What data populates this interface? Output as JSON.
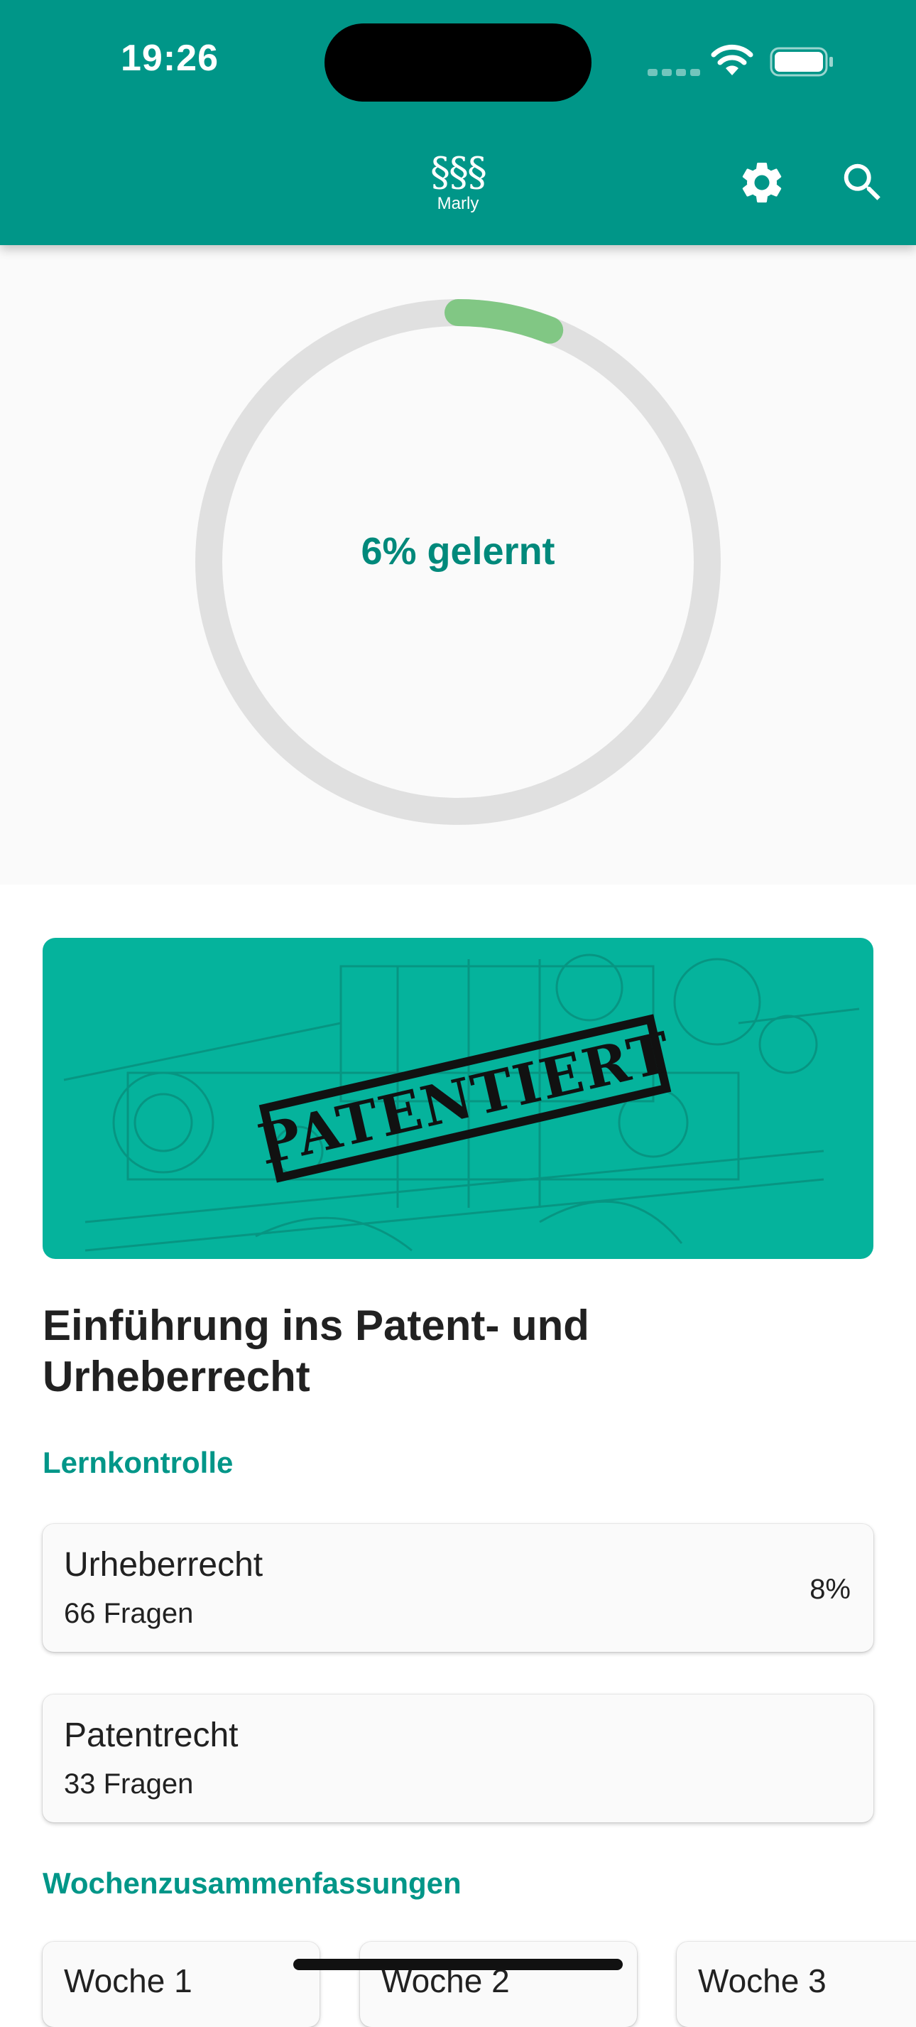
{
  "status_bar": {
    "time": "19:26"
  },
  "app_bar": {
    "logo_mark": "§§§",
    "logo_name": "Marly",
    "settings_icon": "gear-icon",
    "search_icon": "search-icon"
  },
  "progress": {
    "fraction": 0.06,
    "label": "6% gelernt",
    "track_color": "#e0e0e0",
    "fill_color": "#81c784"
  },
  "banner": {
    "stamp_text": "PATENTIERT",
    "background": "#05b39c"
  },
  "course": {
    "title": "Einführung ins Patent- und Urheberrecht"
  },
  "lernkontrolle": {
    "heading": "Lernkontrolle",
    "items": [
      {
        "title": "Urheberrecht",
        "subtitle": "66 Fragen",
        "percent": "8%"
      },
      {
        "title": "Patentrecht",
        "subtitle": "33 Fragen",
        "percent": ""
      }
    ]
  },
  "wochen": {
    "heading": "Wochenzusammenfassungen",
    "items": [
      "Woche 1",
      "Woche 2",
      "Woche 3"
    ]
  },
  "colors": {
    "primary": "#009688",
    "accent_text": "#00897b"
  }
}
